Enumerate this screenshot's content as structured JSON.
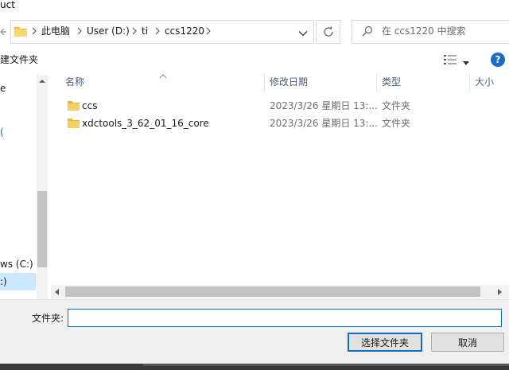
{
  "window": {
    "title_partial": "uct"
  },
  "address": {
    "crumbs": [
      "此电脑",
      "User (D:)",
      "ti",
      "ccs1220"
    ]
  },
  "search": {
    "placeholder": "在 ccs1220 中搜索"
  },
  "toolbar": {
    "new_folder_label": "建文件夹",
    "help_label": "?"
  },
  "nav": {
    "partial_items": [
      "e",
      "(",
      "ws (C:)",
      ":)"
    ]
  },
  "columns": {
    "name": "名称",
    "date": "修改日期",
    "type": "类型",
    "size": "大小"
  },
  "files": [
    {
      "name": "ccs",
      "date": "2023/3/26 星期日 13:...",
      "type": "文件夹"
    },
    {
      "name": "xdctools_3_62_01_16_core",
      "date": "2023/3/26 星期日 13:...",
      "type": "文件夹"
    }
  ],
  "footer": {
    "filename_label": "文件夹:",
    "filename_value": "",
    "select_label": "选择文件夹",
    "cancel_label": "取消"
  },
  "colors": {
    "accent": "#0f6cc8",
    "folder": "#f3c04f",
    "selection": "#cce8ff"
  },
  "icons": [
    "back-arrow-icon",
    "folder-icon",
    "chevron-right-icon",
    "chevron-down-icon",
    "refresh-icon",
    "search-icon",
    "view-list-icon",
    "help-icon",
    "sort-up-icon"
  ]
}
